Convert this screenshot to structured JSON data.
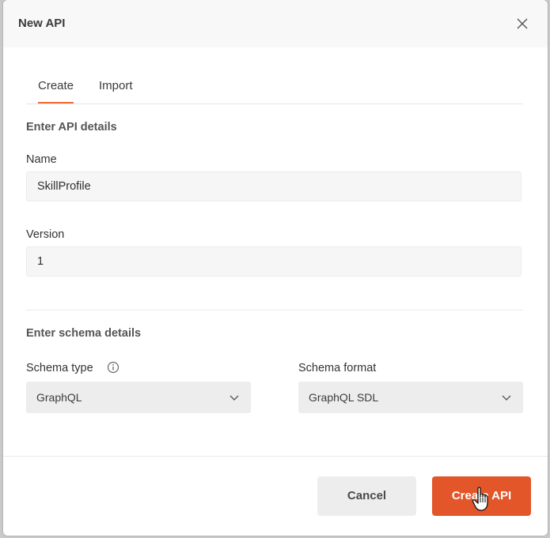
{
  "dialog": {
    "title": "New API"
  },
  "tabs": [
    {
      "label": "Create",
      "active": true
    },
    {
      "label": "Import",
      "active": false
    }
  ],
  "api_details": {
    "section_title": "Enter API details",
    "name_label": "Name",
    "name_value": "SkillProfile",
    "version_label": "Version",
    "version_value": "1"
  },
  "schema_details": {
    "section_title": "Enter schema details",
    "type_label": "Schema type",
    "type_value": "GraphQL",
    "format_label": "Schema format",
    "format_value": "GraphQL SDL"
  },
  "footer": {
    "cancel_label": "Cancel",
    "create_label": "Create API"
  },
  "colors": {
    "accent": "#e3562a",
    "tab_underline": "#f26b3a"
  },
  "icons": {
    "close": "close-icon",
    "info": "info-icon",
    "chevron": "chevron-down-icon",
    "cursor": "hand-pointer-icon"
  }
}
